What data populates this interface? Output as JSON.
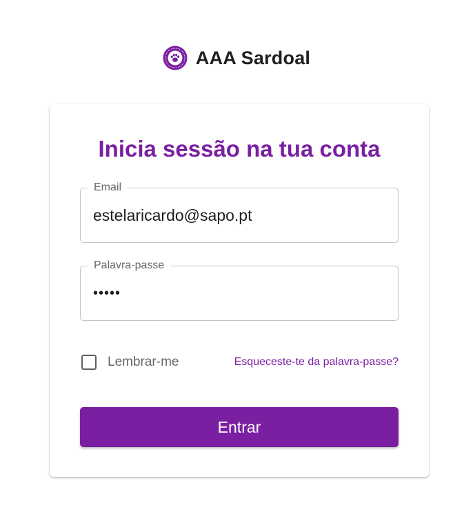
{
  "brand": {
    "name": "AAA Sardoal",
    "logo_icon": "paw-print-icon",
    "accent_color": "#7b1fa2"
  },
  "login": {
    "title": "Inicia sessão na tua conta",
    "email": {
      "label": "Email",
      "value": "estelaricardo@sapo.pt"
    },
    "password": {
      "label": "Palavra-passe",
      "value": "12345"
    },
    "remember_me": {
      "label": "Lembrar-me",
      "checked": false
    },
    "forgot_password": "Esqueceste-te da palavra-passe?",
    "submit_label": "Entrar"
  }
}
